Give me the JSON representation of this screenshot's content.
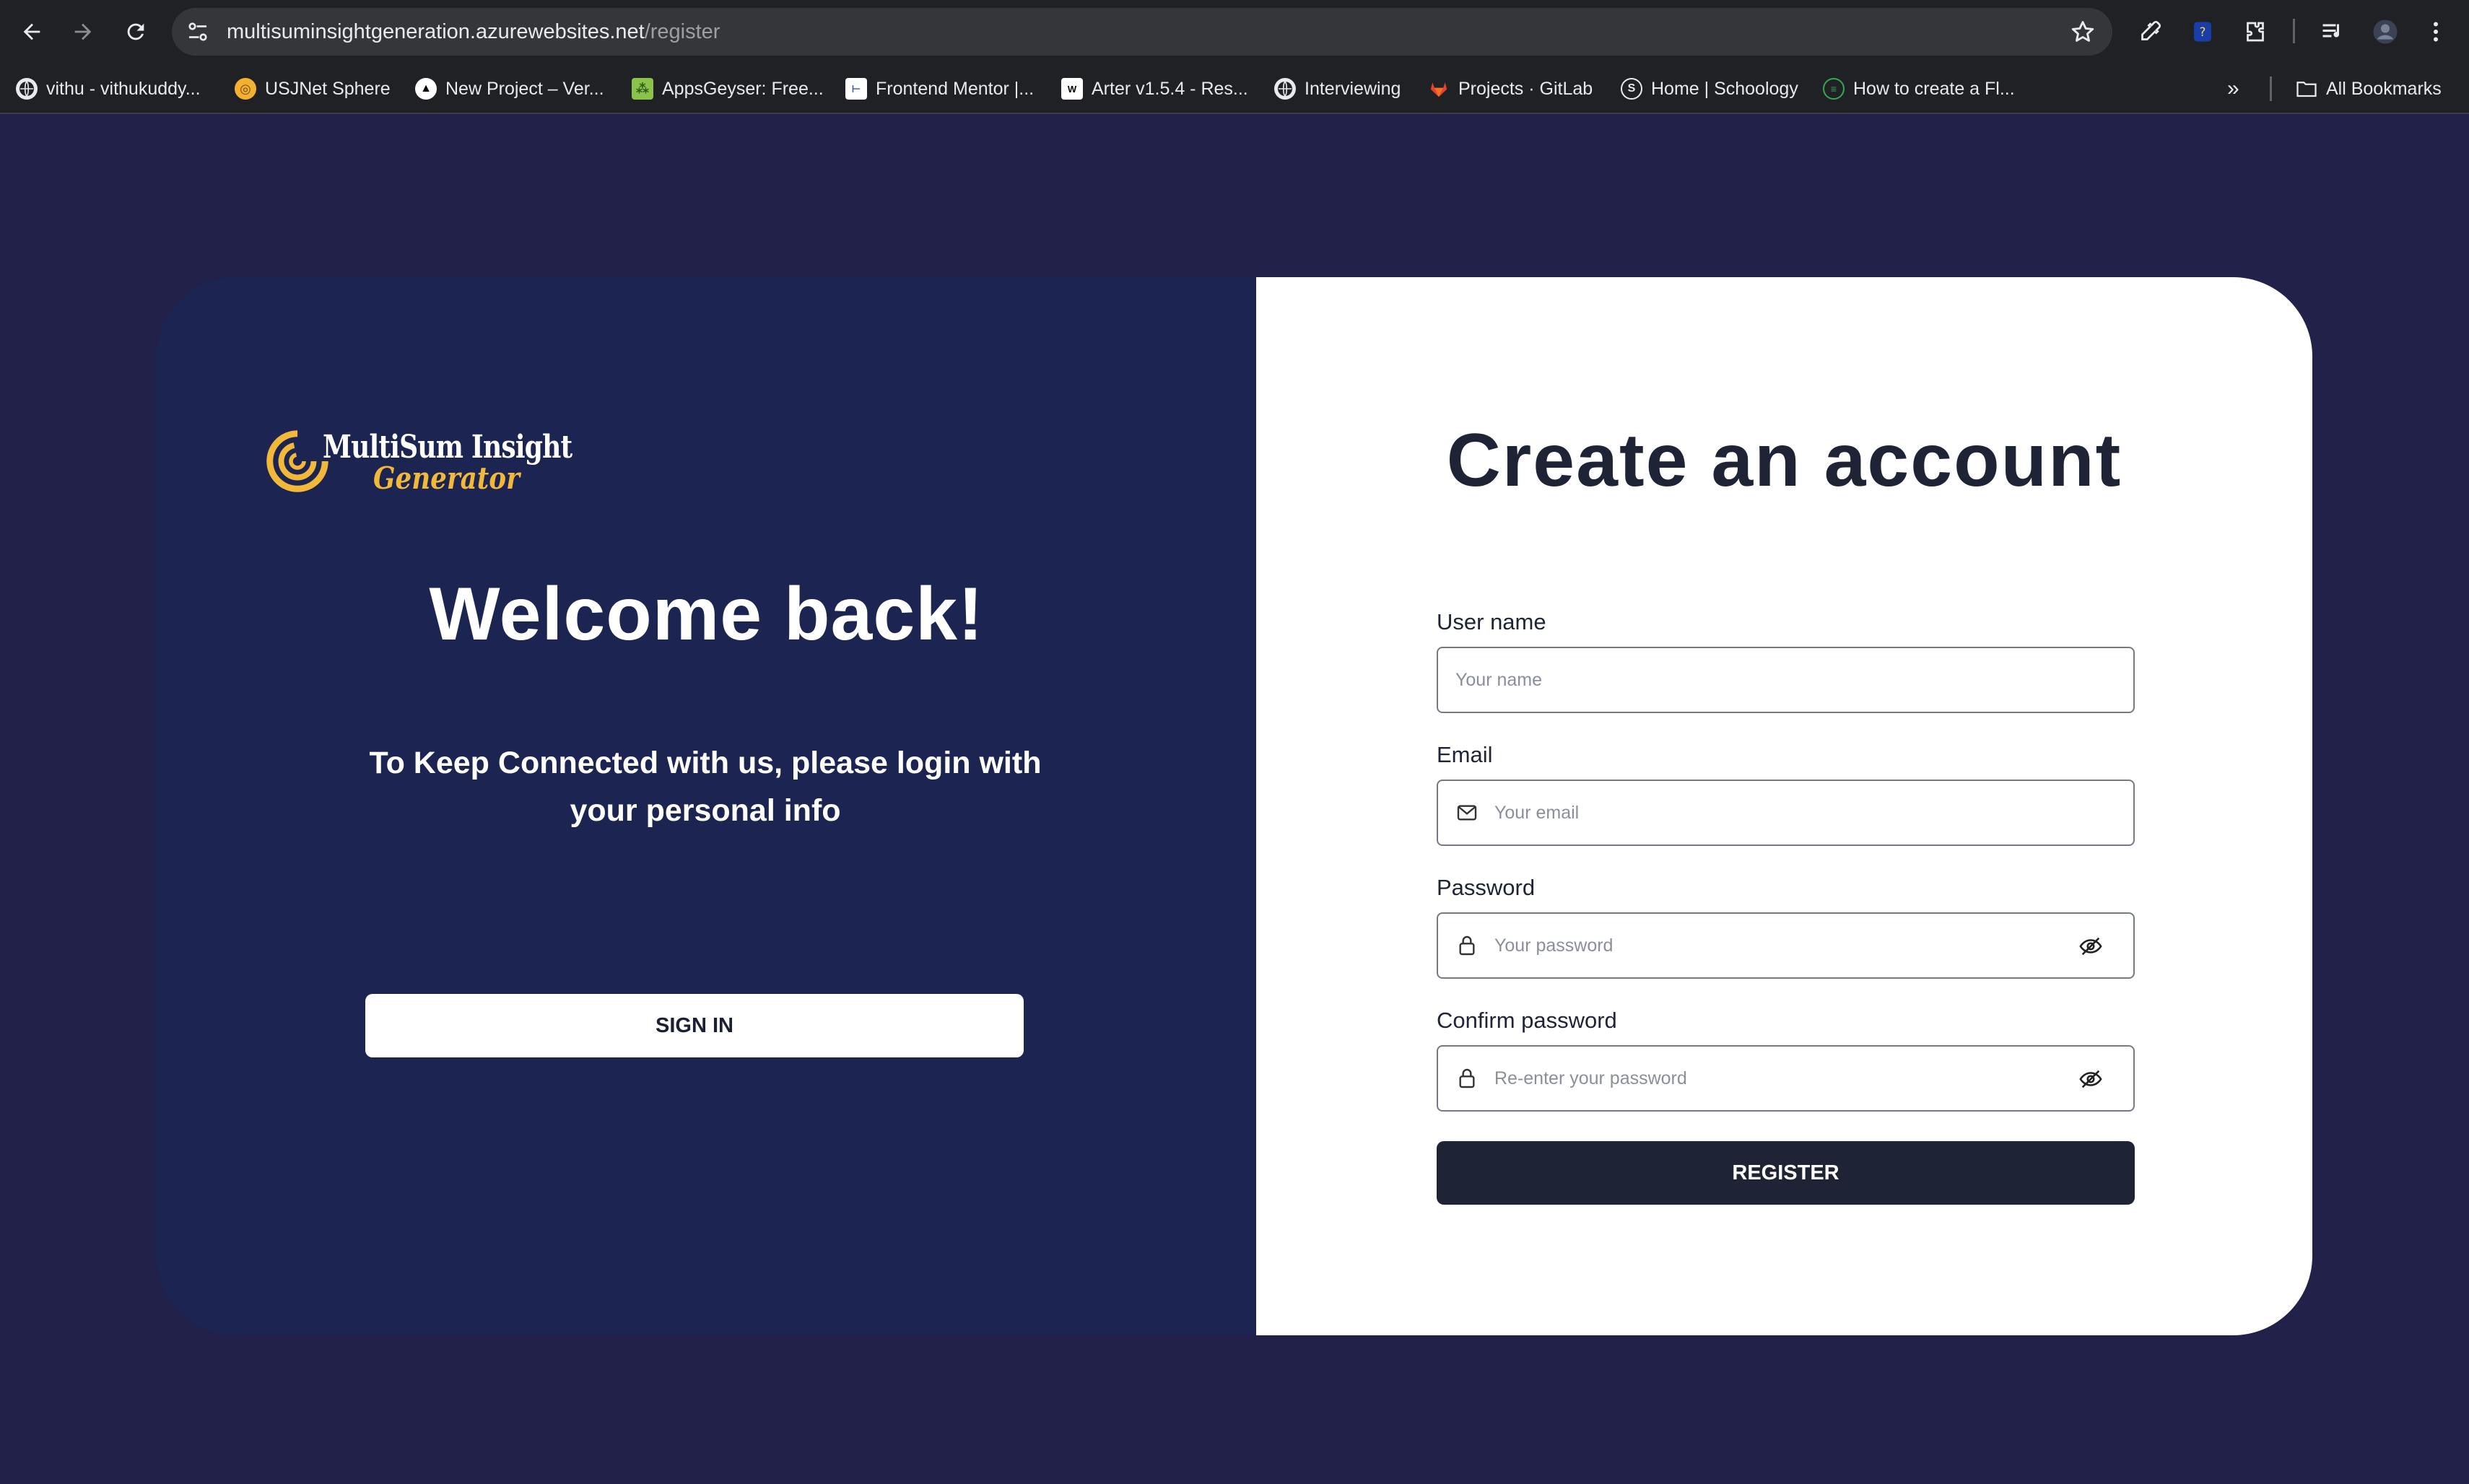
{
  "browser": {
    "url_host": "multisuminsightgeneration.azurewebsites.net",
    "url_path": "/register",
    "bookmarks": [
      {
        "label": "vithu - vithukuddy...",
        "icon": "globe-icon"
      },
      {
        "label": "USJNet Sphere",
        "icon": "usj-icon"
      },
      {
        "label": "New Project – Ver...",
        "icon": "vercel-icon"
      },
      {
        "label": "AppsGeyser: Free...",
        "icon": "appsgeyser-icon"
      },
      {
        "label": "Frontend Mentor |...",
        "icon": "frontend-mentor-icon"
      },
      {
        "label": "Arter v1.5.4 - Res...",
        "icon": "arter-icon"
      },
      {
        "label": "Interviewing",
        "icon": "globe-icon"
      },
      {
        "label": "Projects · GitLab",
        "icon": "gitlab-icon"
      },
      {
        "label": "Home | Schoology",
        "icon": "schoology-icon"
      },
      {
        "label": "How to create a Fl...",
        "icon": "site-icon"
      }
    ],
    "all_bookmarks_label": "All Bookmarks"
  },
  "left": {
    "logo_line1": "MultiSum Insight",
    "logo_line2": "Generator",
    "welcome": "Welcome back!",
    "subtext": "To Keep Connected with us, please login with your personal info",
    "signin_label": "SIGN IN"
  },
  "right": {
    "title": "Create an account",
    "username_label": "User name",
    "username_placeholder": "Your name",
    "email_label": "Email",
    "email_placeholder": "Your email",
    "password_label": "Password",
    "password_placeholder": "Your password",
    "confirm_label": "Confirm password",
    "confirm_placeholder": "Re-enter your password",
    "register_label": "REGISTER"
  },
  "colors": {
    "page_bg": "#21214a",
    "left_panel": "#1c2452",
    "dark_button": "#1e2435",
    "logo_accent": "#f2b83a"
  }
}
